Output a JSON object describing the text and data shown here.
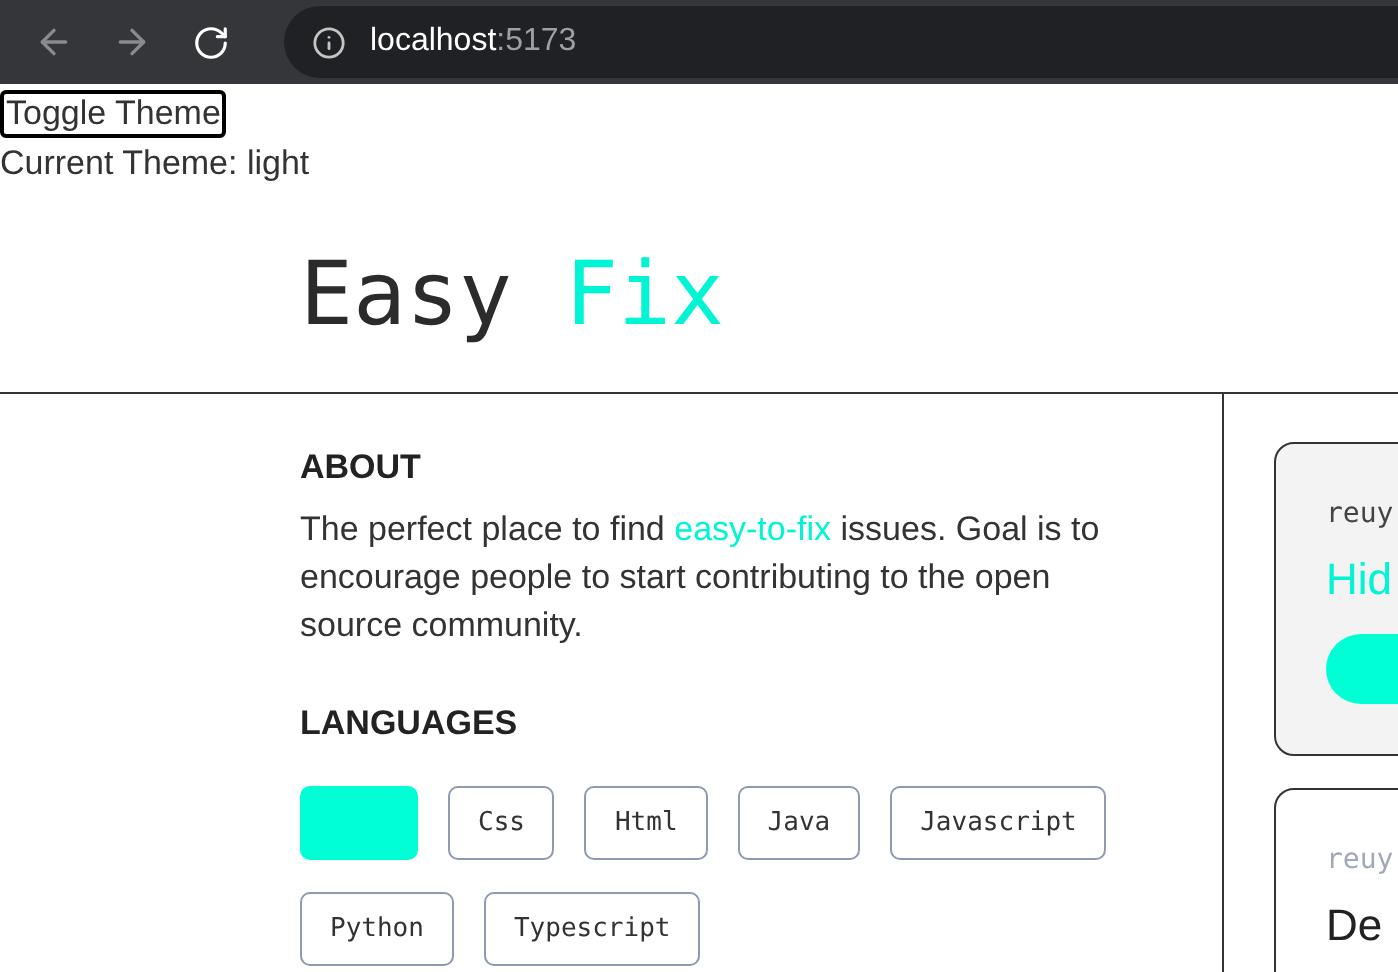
{
  "browser": {
    "url_host": "localhost",
    "url_port": ":5173"
  },
  "toggle_button": "Toggle Theme",
  "current_theme": "Current Theme: light",
  "logo": {
    "first": "Easy",
    "second": "Fix"
  },
  "about": {
    "heading": "ABOUT",
    "text_before": "The perfect place to find ",
    "link": "easy-to-fix",
    "text_after": " issues. Goal is to encourage people to start contributing to the open source community."
  },
  "languages": {
    "heading": "LANGUAGES",
    "items": [
      {
        "selected": true
      },
      {
        "label": "Css",
        "selected": false
      },
      {
        "label": "Html",
        "selected": false
      },
      {
        "label": "Java",
        "selected": false
      },
      {
        "label": "Javascript",
        "selected": false
      },
      {
        "label": "Python",
        "selected": false
      },
      {
        "label": "Typescript",
        "selected": false
      }
    ]
  },
  "issues": [
    {
      "repo": "reuy",
      "title": "Hid",
      "selected": true
    },
    {
      "repo": "reuy",
      "title": "De",
      "selected": false
    }
  ]
}
